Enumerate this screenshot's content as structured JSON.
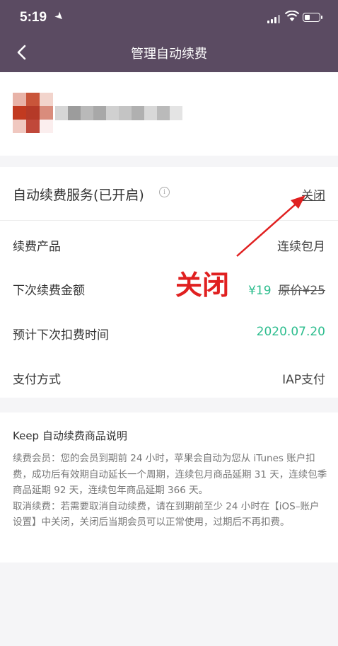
{
  "status_bar": {
    "time": "5:19"
  },
  "header": {
    "title": "管理自动续费"
  },
  "service": {
    "label": "自动续费服务(已开启)",
    "close_label": "关闭"
  },
  "rows": [
    {
      "label": "续费产品",
      "value": "连续包月"
    },
    {
      "label": "下次续费金额",
      "price_now": "¥19",
      "price_original": "原价¥25"
    },
    {
      "label": "预计下次扣费时间",
      "value": "2020.07.20"
    },
    {
      "label": "支付方式",
      "value": "IAP支付"
    }
  ],
  "annotation": {
    "text": "关闭",
    "color": "#e02020"
  },
  "description": {
    "title": "Keep 自动续费商品说明",
    "paragraphs": [
      "续费会员：您的会员到期前 24 小时，苹果会自动为您从 iTunes 账户扣费，成功后有效期自动延长一个周期，连续包月商品延期 31 天，连续包季商品延期 92 天，连续包年商品延期 366 天。",
      "取消续费：若需要取消自动续费，请在到期前至少 24 小时在【iOS–账户设置】中关闭，关闭后当期会员可以正常使用，过期后不再扣费。"
    ]
  },
  "colors": {
    "header_bg": "#5b4b62",
    "accent_green": "#2dbd8e"
  }
}
